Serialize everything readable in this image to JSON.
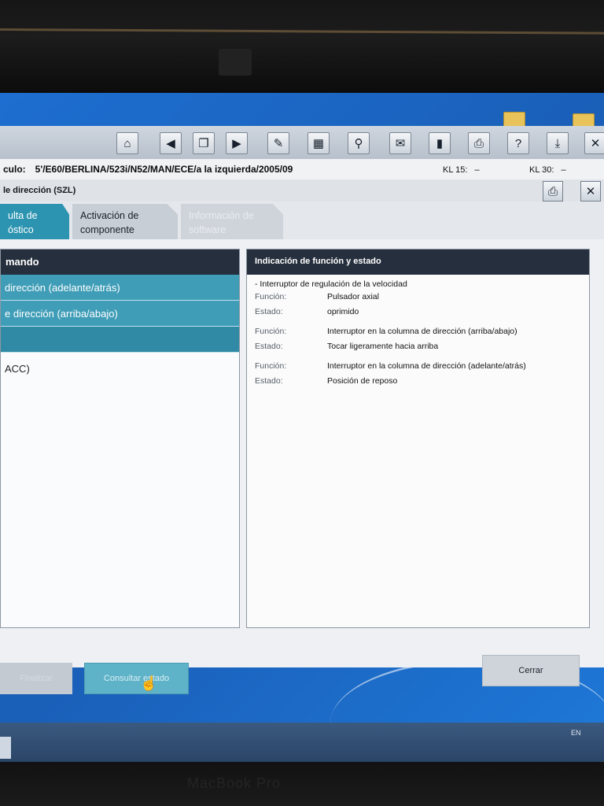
{
  "hardware": {
    "brand": "MacBook Pro"
  },
  "toolbar": {
    "buttons": [
      "home",
      "back",
      "copy",
      "forward",
      "wrench",
      "diagnostics",
      "link",
      "mail",
      "battery",
      "print",
      "help",
      "download",
      "close"
    ],
    "help_label": "?",
    "close_label": "✕"
  },
  "vehicle": {
    "label": "culo:",
    "value": "5'/E60/BERLINA/523i/N52/MAN/ECE/a la izquierda/2005/09",
    "kl15_label": "KL 15:",
    "kl15_value": "–",
    "kl30_label": "KL 30:",
    "kl30_value": "–"
  },
  "module": {
    "title": "le dirección (SZL)",
    "close_label": "✕"
  },
  "tabs": [
    {
      "label": "ulta de\nóstico",
      "state": "active"
    },
    {
      "label": "Activación de\ncomponente",
      "state": "normal"
    },
    {
      "label": "Información de\nsoftware",
      "state": "disabled"
    }
  ],
  "left_panel": {
    "header": "mando",
    "items": [
      {
        "label": "dirección (adelante/atrás)",
        "selected": true
      },
      {
        "label": "e dirección (arriba/abajo)",
        "selected": true
      },
      {
        "label": "",
        "selected": true
      },
      {
        "label": "ACC)",
        "selected": false
      }
    ]
  },
  "right_panel": {
    "header": "Indicación de función y estado",
    "section_title": "- Interruptor de regulación de la velocidad",
    "entries": [
      {
        "funcion_label": "Función:",
        "funcion": "Pulsador axial",
        "estado_label": "Estado:",
        "estado": "oprimido"
      },
      {
        "funcion_label": "Función:",
        "funcion": "Interruptor en la columna de dirección (arriba/abajo)",
        "estado_label": "Estado:",
        "estado": "Tocar ligeramente hacia arriba"
      },
      {
        "funcion_label": "Función:",
        "funcion": "Interruptor en la columna de dirección (adelante/atrás)",
        "estado_label": "Estado:",
        "estado": "Posición de reposo"
      }
    ]
  },
  "footer": {
    "ghost_label": "Finalizar",
    "consultar_label": "Consultar estado",
    "cerrar_label": "Cerrar"
  },
  "taskbar": {
    "language": "EN"
  }
}
